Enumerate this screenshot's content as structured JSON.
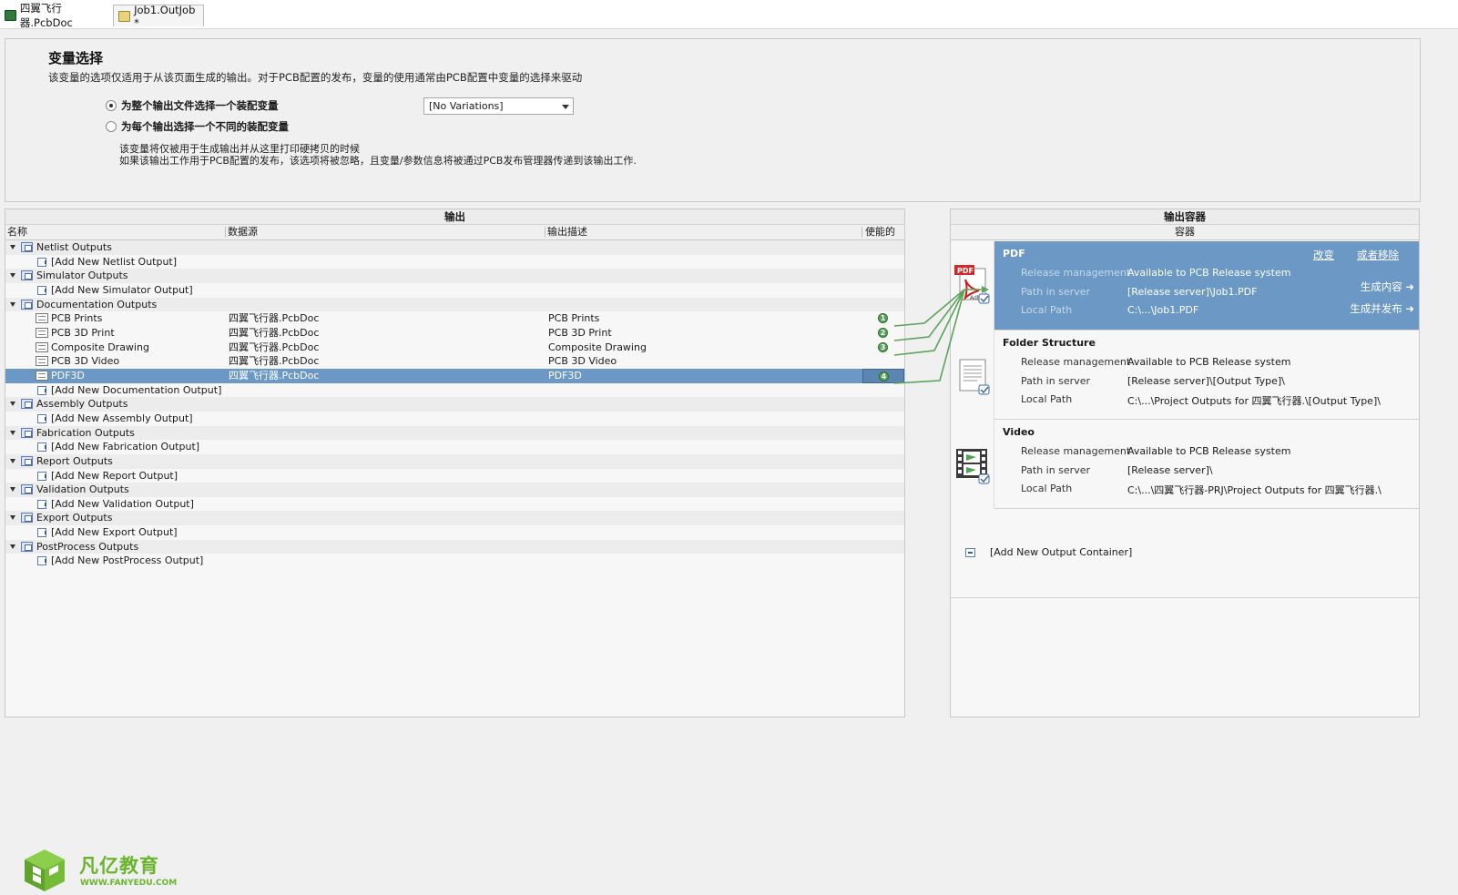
{
  "tabs": [
    {
      "label": "四翼飞行器.PcbDoc"
    },
    {
      "label": "Job1.OutJob *"
    }
  ],
  "variant": {
    "title": "变量选择",
    "description": "该变量的选项仅适用于从该页面生成的输出。对于PCB配置的发布，变量的使用通常由PCB配置中变量的选择来驱动",
    "option_single": "为整个输出文件选择一个装配变量",
    "option_each": "为每个输出选择一个不同的装配变量",
    "select_value": "[No Variations]",
    "note_line1": "该变量将仅被用于生成输出并从这里打印硬拷贝的时候",
    "note_line2": "如果该输出工作用于PCB配置的发布，该选项将被忽略，且变量/参数信息将被通过PCB发布管理器传递到该输出工作."
  },
  "outputs": {
    "panel_title": "输出",
    "columns": {
      "name": "名称",
      "source": "数据源",
      "description": "输出描述",
      "enabled": "使能的"
    },
    "groups": [
      {
        "name": "Netlist Outputs",
        "add": "[Add New Netlist Output]",
        "items": []
      },
      {
        "name": "Simulator Outputs",
        "add": "[Add New Simulator Output]",
        "items": []
      },
      {
        "name": "Documentation Outputs",
        "add": "[Add New Documentation Output]",
        "items": [
          {
            "name": "PCB Prints",
            "source": "四翼飞行器.PcbDoc",
            "desc": "PCB Prints",
            "enabled": "1"
          },
          {
            "name": "PCB 3D Print",
            "source": "四翼飞行器.PcbDoc",
            "desc": "PCB 3D Print",
            "enabled": "2"
          },
          {
            "name": "Composite Drawing",
            "source": "四翼飞行器.PcbDoc",
            "desc": "Composite Drawing",
            "enabled": "3"
          },
          {
            "name": "PCB 3D Video",
            "source": "四翼飞行器.PcbDoc",
            "desc": "PCB 3D Video",
            "enabled": ""
          },
          {
            "name": "PDF3D",
            "source": "四翼飞行器.PcbDoc",
            "desc": "PDF3D",
            "enabled": "4",
            "selected": true
          }
        ]
      },
      {
        "name": "Assembly Outputs",
        "add": "[Add New Assembly Output]",
        "items": []
      },
      {
        "name": "Fabrication Outputs",
        "add": "[Add New Fabrication Output]",
        "items": []
      },
      {
        "name": "Report Outputs",
        "add": "[Add New Report Output]",
        "items": []
      },
      {
        "name": "Validation Outputs",
        "add": "[Add New Validation Output]",
        "items": []
      },
      {
        "name": "Export Outputs",
        "add": "[Add New Export Output]",
        "items": []
      },
      {
        "name": "PostProcess Outputs",
        "add": "[Add New PostProcess Output]",
        "items": []
      }
    ]
  },
  "containers": {
    "panel_title": "输出容器",
    "sub_header": "容器",
    "cards": [
      {
        "title": "PDF",
        "icon": "pdf-icon",
        "selected": true,
        "rows": [
          {
            "label": "Release management",
            "value": "Available to PCB Release system"
          },
          {
            "label": "Path in server",
            "value": "[Release server]\\Job1.PDF"
          },
          {
            "label": "Local Path",
            "value": "C:\\...\\Job1.PDF"
          }
        ]
      },
      {
        "title": "Folder Structure",
        "icon": "folder-document-icon",
        "selected": false,
        "rows": [
          {
            "label": "Release management",
            "value": "Available to PCB Release system"
          },
          {
            "label": "Path in server",
            "value": "[Release server]\\[Output Type]\\"
          },
          {
            "label": "Local Path",
            "value": "C:\\...\\Project Outputs for 四翼飞行器.\\[Output Type]\\"
          }
        ]
      },
      {
        "title": "Video",
        "icon": "film-icon",
        "selected": false,
        "rows": [
          {
            "label": "Release management",
            "value": "Available to PCB Release system"
          },
          {
            "label": "Path in server",
            "value": "[Release server]\\"
          },
          {
            "label": "Local Path",
            "value": "C:\\...\\四翼飞行器-PRJ\\Project Outputs for 四翼飞行器.\\"
          }
        ]
      }
    ],
    "link_change": "改变",
    "link_remove": "或者移除",
    "action_generate": "生成内容 ➜",
    "action_generate_publish": "生成并发布 ➜",
    "add_container": "[Add New Output Container]"
  },
  "logo": {
    "brand": "凡亿教育",
    "url": "WWW.FANYEDU.COM"
  },
  "colors": {
    "selection": "#6b98c4",
    "connector": "#5aa35a",
    "brand": "#6ab42d"
  }
}
